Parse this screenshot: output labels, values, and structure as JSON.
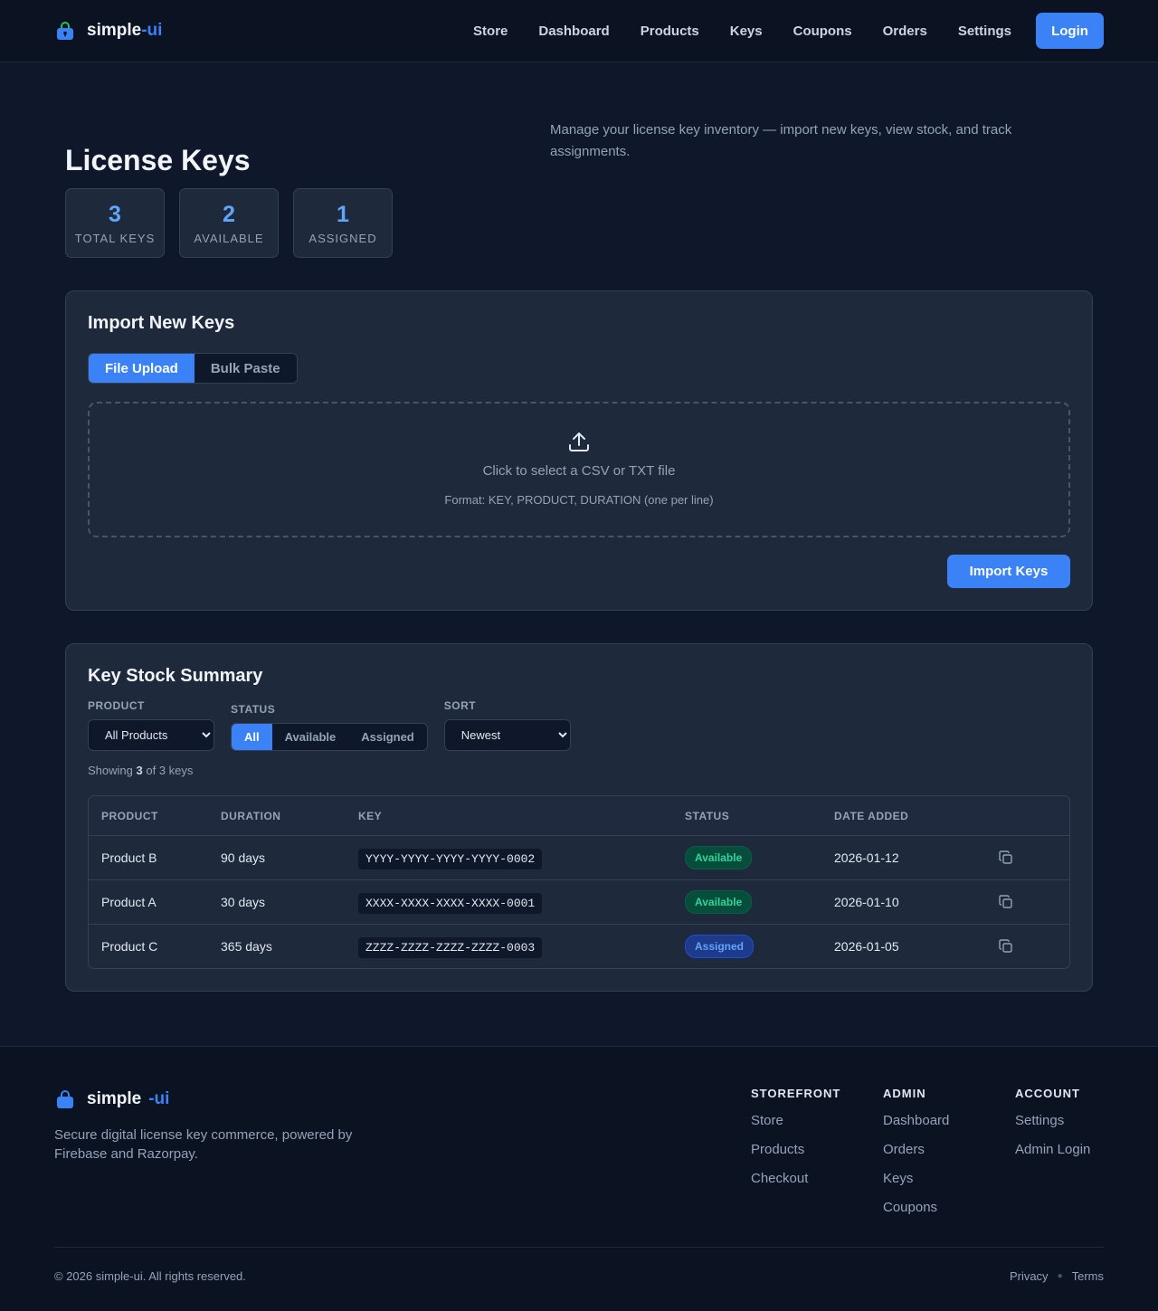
{
  "brand": {
    "name": "simple",
    "accent": "-ui",
    "icon": "shopping-bag-lock-icon"
  },
  "nav": {
    "items": [
      "Store",
      "Dashboard",
      "Products",
      "Keys",
      "Coupons",
      "Orders",
      "Settings"
    ],
    "login_label": "Login"
  },
  "page": {
    "title": "License Keys",
    "description": "Manage your license key inventory — import new keys, view stock, and track assignments."
  },
  "stats": [
    {
      "value": "3",
      "label": "TOTAL KEYS"
    },
    {
      "value": "2",
      "label": "AVAILABLE"
    },
    {
      "value": "1",
      "label": "ASSIGNED"
    }
  ],
  "import": {
    "title": "Import New Keys",
    "tabs": [
      "File Upload",
      "Bulk Paste"
    ],
    "active_tab": "File Upload",
    "drop_text": "Click to select a CSV or TXT file",
    "format_text": "Format: KEY, PRODUCT, DURATION (one per line)",
    "button_label": "Import Keys"
  },
  "summary": {
    "title": "Key Stock Summary",
    "product_label": "PRODUCT",
    "product_value": "All Products",
    "status_label": "STATUS",
    "status_options": [
      "All",
      "Available",
      "Assigned"
    ],
    "status_selected": "All",
    "sort_label": "SORT",
    "sort_value": "Newest",
    "showing_prefix": "Showing",
    "showing_count": "3",
    "showing_suffix": "of 3 keys",
    "columns": [
      "PRODUCT",
      "DURATION",
      "KEY",
      "STATUS",
      "DATE ADDED"
    ],
    "rows": [
      {
        "product": "Product B",
        "duration": "90 days",
        "key": "YYYY-YYYY-YYYY-YYYY-0002",
        "status": "Available",
        "date": "2026-01-12"
      },
      {
        "product": "Product A",
        "duration": "30 days",
        "key": "XXXX-XXXX-XXXX-XXXX-0001",
        "status": "Available",
        "date": "2026-01-10"
      },
      {
        "product": "Product C",
        "duration": "365 days",
        "key": "ZZZZ-ZZZZ-ZZZZ-ZZZZ-0003",
        "status": "Assigned",
        "date": "2026-01-05"
      }
    ]
  },
  "footer": {
    "tagline": "Secure digital license key commerce, powered by Firebase and Razorpay.",
    "columns": [
      {
        "title": "STOREFRONT",
        "links": [
          "Store",
          "Products",
          "Checkout"
        ]
      },
      {
        "title": "ADMIN",
        "links": [
          "Dashboard",
          "Orders",
          "Keys",
          "Coupons"
        ]
      },
      {
        "title": "ACCOUNT",
        "links": [
          "Settings",
          "Admin Login"
        ]
      }
    ],
    "copyright": "© 2026 simple-ui. All rights reserved.",
    "legal": [
      "Privacy",
      "Terms"
    ]
  },
  "colors": {
    "accent": "#3b82f6",
    "background": "#0f172a",
    "card": "#1e293b",
    "available": "#34d399",
    "assigned": "#60a5fa"
  }
}
